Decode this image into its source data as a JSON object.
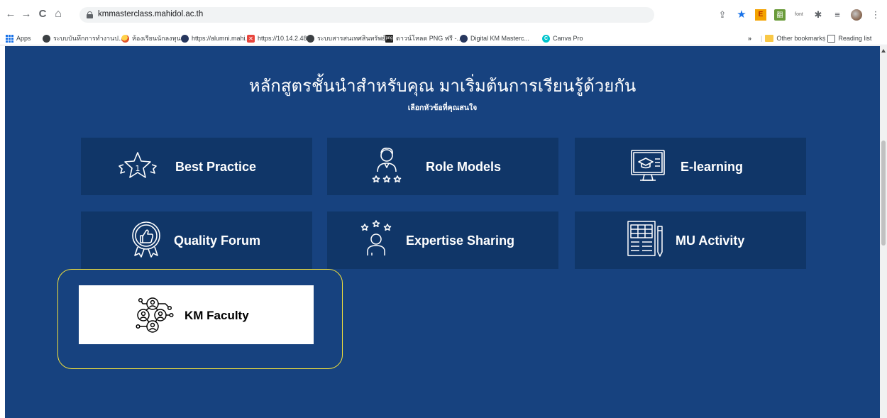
{
  "browser": {
    "url": "kmmasterclass.mahidol.ac.th",
    "bookmarks": [
      {
        "label": "Apps",
        "icon": "apps-grid-icon"
      },
      {
        "label": "ระบบบันทึกการทำงานป...",
        "icon": "globe-icon"
      },
      {
        "label": "ห้องเรียนนักลงทุน",
        "icon": "investor-class-icon"
      },
      {
        "label": "https://alumni.mahi...",
        "icon": "alumni-icon"
      },
      {
        "label": "https://10.14.2.48",
        "icon": "red-x-icon"
      },
      {
        "label": "ระบบสารสนเทศสินทรัพย์ถา",
        "icon": "globe-icon"
      },
      {
        "label": "ดาวน์โหลด PNG ฟรี -...",
        "icon": "png-icon"
      },
      {
        "label": "Digital KM Masterc...",
        "icon": "km-icon"
      },
      {
        "label": "Canva Pro",
        "icon": "canva-icon"
      }
    ],
    "overflow": "»",
    "other_bookmarks": "Other bookmarks",
    "reading_list": "Reading list",
    "toolbar_font": "font"
  },
  "page": {
    "headline": "หลักสูตรชั้นนำสำหรับคุณ มาเริ่มต้นการเรียนรู้ด้วยกัน",
    "subline": "เลือกหัวข้อที่คุณสนใจ",
    "background_color": "#17427f",
    "card_color": "#103668",
    "highlight_color": "#f4e23b",
    "cards": [
      {
        "label": "Best Practice",
        "icon": "award-star-icon"
      },
      {
        "label": "Role Models",
        "icon": "role-model-person-icon"
      },
      {
        "label": "E-learning",
        "icon": "e-learning-monitor-icon"
      },
      {
        "label": "Quality Forum",
        "icon": "thumbs-up-badge-icon"
      },
      {
        "label": "Expertise Sharing",
        "icon": "expert-stars-icon"
      },
      {
        "label": "MU Activity",
        "icon": "calendar-document-icon"
      },
      {
        "label": "KM Faculty",
        "icon": "network-people-icon"
      }
    ]
  }
}
